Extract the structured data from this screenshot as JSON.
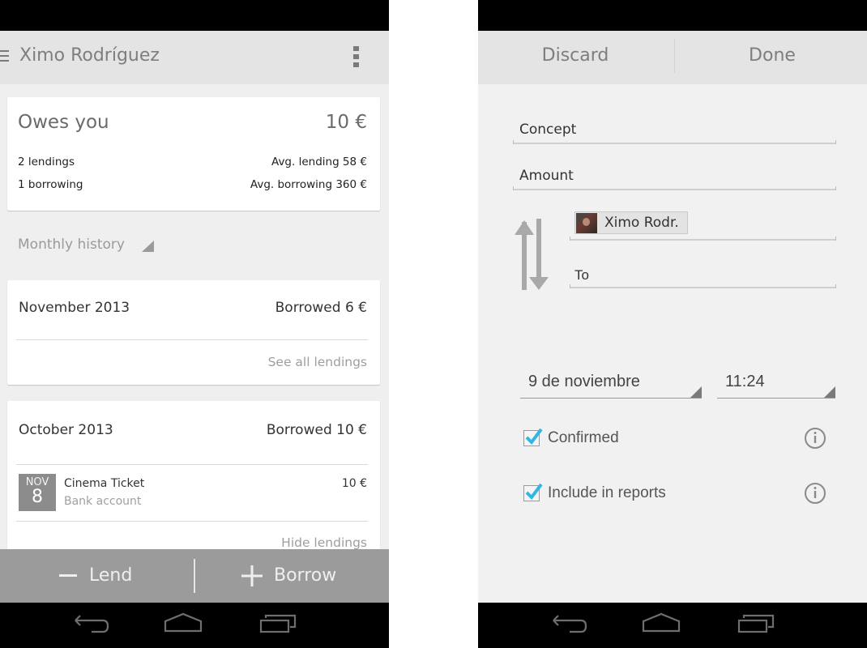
{
  "left_screen": {
    "action_bar": {
      "title": "Ximo Rodríguez",
      "drawer_icon": "hamburger-icon",
      "overflow_icon": "more-vert-icon"
    },
    "summary": {
      "label": "Owes you",
      "amount": "10 €",
      "lendings_count": "2 lendings",
      "borrowings_count": "1 borrowing",
      "avg_lending": "Avg. lending 58 €",
      "avg_borrowing": "Avg. borrowing 360 €"
    },
    "history_selector": {
      "label": "Monthly history"
    },
    "months": [
      {
        "title": "November 2013",
        "value": "Borrowed 6 €",
        "link": "See all lendings",
        "entries": []
      },
      {
        "title": "October 2013",
        "value": "Borrowed 10 €",
        "link": "Hide lendings",
        "entries": [
          {
            "month": "NOV",
            "day": "8",
            "title": "Cinema Ticket",
            "subtitle": "Bank account",
            "amount": "10 €"
          }
        ]
      }
    ],
    "bottom_actions": {
      "lend_label": "Lend",
      "lend_icon": "minus-icon",
      "borrow_label": "Borrow",
      "borrow_icon": "plus-icon"
    }
  },
  "right_screen": {
    "action_bar": {
      "discard_label": "Discard",
      "done_label": "Done"
    },
    "form": {
      "concept_placeholder": "Concept",
      "amount_placeholder": "Amount",
      "from_chip": "Ximo Rodr.",
      "to_placeholder": "To",
      "date": "9 de noviembre",
      "time": "11:24",
      "confirmed_label": "Confirmed",
      "confirmed_checked": true,
      "include_reports_label": "Include in reports",
      "include_reports_checked": true
    }
  },
  "system_nav": {
    "back": "back-icon",
    "home": "home-icon",
    "recents": "recents-icon"
  },
  "colors": {
    "checkbox_accent": "#33b5e5",
    "action_bar": "#e4e4e4",
    "bottom_actions": "#9b9b9b"
  }
}
